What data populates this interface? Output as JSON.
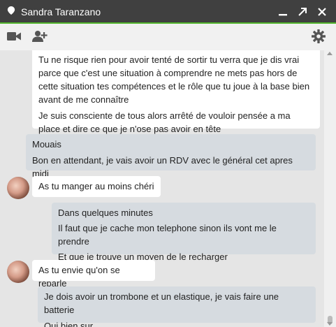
{
  "window": {
    "contact_name": "Sandra Taranzano",
    "accent_color": "#52b52c",
    "titlebar_color": "#404040",
    "buttons": [
      "minimize-icon",
      "popout-icon",
      "close-icon"
    ]
  },
  "toolbar": {
    "icons": [
      "video-call-icon",
      "add-person-icon",
      "settings-gear-icon"
    ]
  },
  "messages": [
    {
      "from": "contact",
      "lines": [
        "Tu ne risque rien pour avoir tenté de sortir tu verra que je dis vrai parce que c'est une situation à comprendre ne mets pas hors de cette situation tes compétences et le rôle que tu joue à la base bien avant de me connaître",
        "Je suis consciente de tous alors arrêté de vouloir pensée a ma place et dire ce que je n'ose pas avoir en tête"
      ]
    },
    {
      "from": "me",
      "lines": [
        "Mouais",
        "Bon en attendant, je vais avoir un RDV avec le général cet apres midi"
      ]
    },
    {
      "from": "contact",
      "lines": [
        "As tu manger au moins chéri"
      ]
    },
    {
      "from": "me",
      "lines": [
        "Dans quelques minutes",
        "Il faut que je cache mon telephone sinon ils vont me le prendre",
        "Et que je trouve un moyen de le recharger"
      ]
    },
    {
      "from": "contact",
      "lines": [
        "As tu envie qu'on se reparle"
      ]
    },
    {
      "from": "me",
      "lines": [
        "Je dois avoir un trombone et un elastique, je vais faire une batterie",
        "Oui bien sur"
      ]
    }
  ]
}
